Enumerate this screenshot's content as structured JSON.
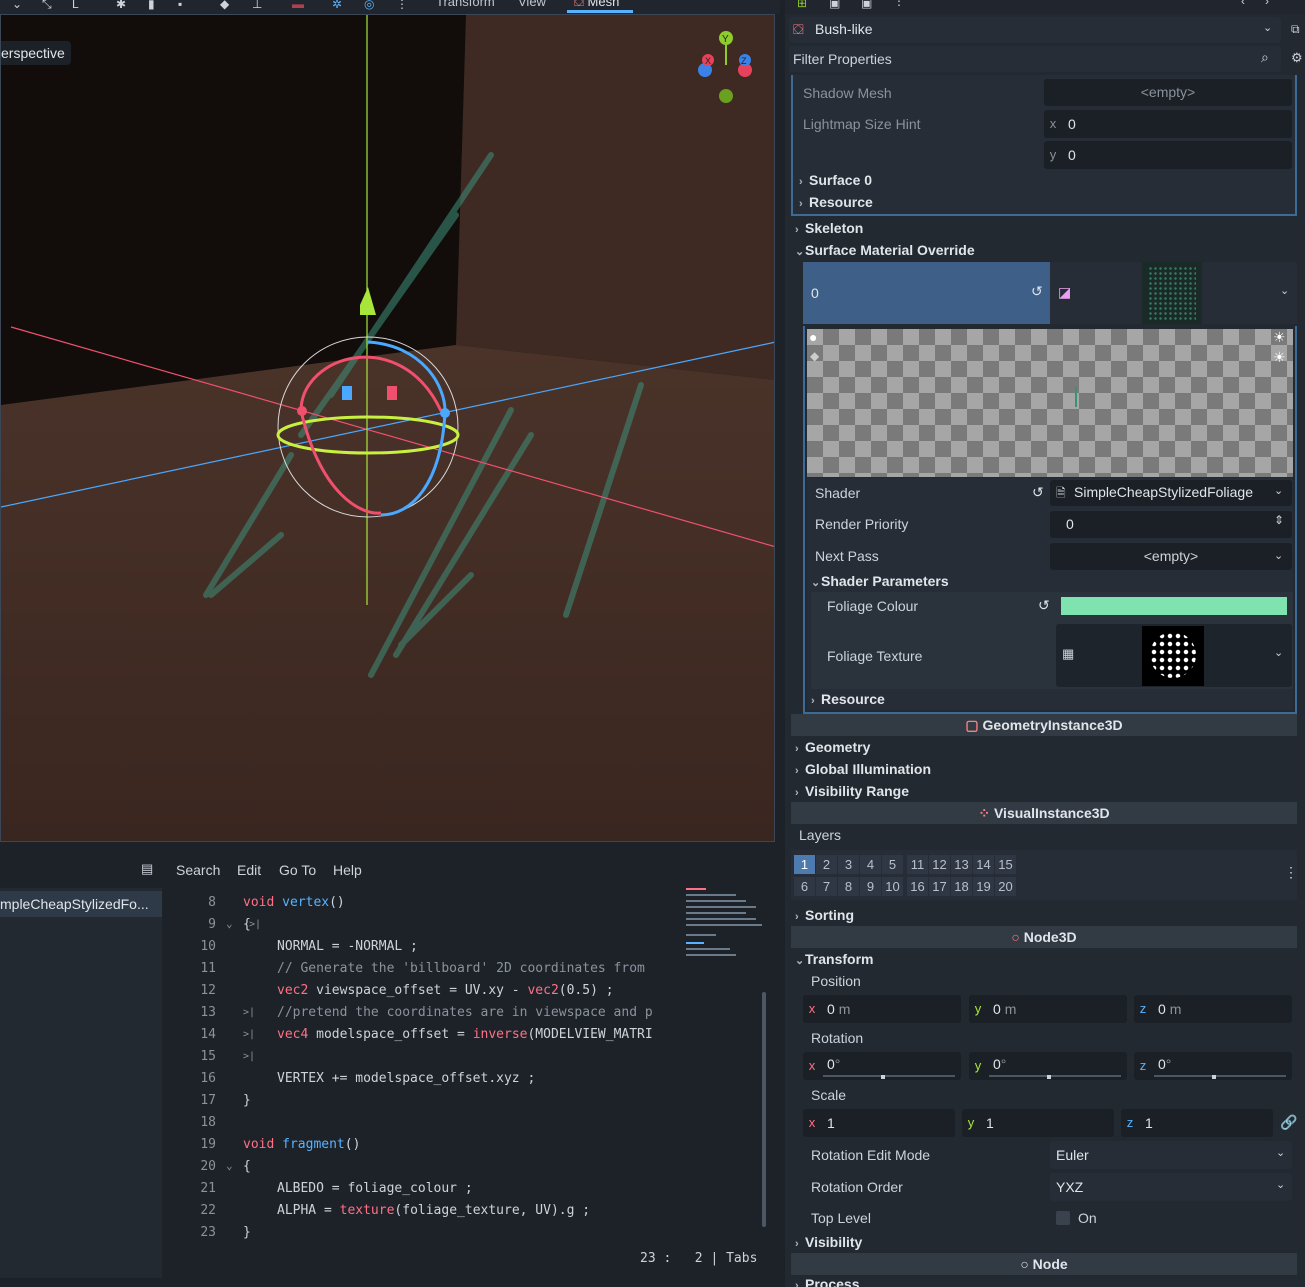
{
  "toolbar": {
    "menus": [
      "Transform",
      "View",
      "Mesh"
    ]
  },
  "viewport": {
    "perspective_label": "erspective",
    "gizmo_axes": [
      "Y",
      "X",
      "Z"
    ]
  },
  "inspector": {
    "resource_name": "Bush-like",
    "filter_placeholder": "Filter Properties",
    "shadow_mesh_label": "Shadow Mesh",
    "shadow_mesh_value": "<empty>",
    "lightmap_label": "Lightmap Size Hint",
    "lightmap_x": "0",
    "lightmap_y": "0",
    "surface0": "Surface 0",
    "resource1": "Resource",
    "skeleton": "Skeleton",
    "surface_override": "Surface Material Override",
    "override_index": "0",
    "shader_label": "Shader",
    "shader_value": "SimpleCheapStylizedFoliage",
    "render_priority_label": "Render Priority",
    "render_priority_value": "0",
    "next_pass_label": "Next Pass",
    "next_pass_value": "<empty>",
    "shader_params": "Shader Parameters",
    "foliage_colour_label": "Foliage Colour",
    "foliage_colour": "#7fe3b0",
    "foliage_texture_label": "Foliage Texture",
    "resource2": "Resource",
    "geometry_instance": "GeometryInstance3D",
    "geometry": "Geometry",
    "global_illum": "Global Illumination",
    "visibility_range": "Visibility Range",
    "visual_instance": "VisualInstance3D",
    "layers_label": "Layers",
    "layers_row1": [
      "1",
      "2",
      "3",
      "4",
      "5",
      "11",
      "12",
      "13",
      "14",
      "15"
    ],
    "layers_row2": [
      "6",
      "7",
      "8",
      "9",
      "10",
      "16",
      "17",
      "18",
      "19",
      "20"
    ],
    "sorting": "Sorting",
    "node3d": "Node3D",
    "transform": "Transform",
    "position_label": "Position",
    "pos_x": "0",
    "pos_y": "0",
    "pos_z": "0",
    "unit_m": "m",
    "rotation_label": "Rotation",
    "rot_x": "0",
    "rot_y": "0",
    "rot_z": "0",
    "deg": "°",
    "scale_label": "Scale",
    "scale_x": "1",
    "scale_y": "1",
    "scale_z": "1",
    "rot_mode_label": "Rotation Edit Mode",
    "rot_mode_value": "Euler",
    "rot_order_label": "Rotation Order",
    "rot_order_value": "YXZ",
    "top_level_label": "Top Level",
    "top_level_value": "On",
    "visibility": "Visibility",
    "node": "Node",
    "process": "Process"
  },
  "script": {
    "menus": [
      "Search",
      "Edit",
      "Go To",
      "Help"
    ],
    "file": "mpleCheapStylizedFo...",
    "status_line": "23 :",
    "status_col": "2",
    "status_indent": "Tabs",
    "lines": [
      {
        "n": "8"
      },
      {
        "n": "9"
      },
      {
        "n": "10"
      },
      {
        "n": "11"
      },
      {
        "n": "12"
      },
      {
        "n": "13"
      },
      {
        "n": "14"
      },
      {
        "n": "15"
      },
      {
        "n": "16"
      },
      {
        "n": "17"
      },
      {
        "n": "18"
      },
      {
        "n": "19"
      },
      {
        "n": "20"
      },
      {
        "n": "21"
      },
      {
        "n": "22"
      },
      {
        "n": "23"
      }
    ],
    "code": {
      "l8a": "void",
      "l8b": "vertex",
      "l8c": "()",
      "l9": "{",
      "l10": "NORMAL = -NORMAL ;",
      "l11": "// Generate the 'billboard' 2D coordinates from",
      "l12a": "vec2",
      "l12b": " viewspace_offset = UV.xy - ",
      "l12c": "vec2",
      "l12d": "(0.5) ;",
      "l13": "//pretend the coordinates are in viewspace and p",
      "l14a": "vec4",
      "l14b": " modelspace_offset = ",
      "l14c": "inverse",
      "l14d": "(MODELVIEW_MATRI",
      "l16": "VERTEX += modelspace_offset.xyz ;",
      "l17": "}",
      "l19a": "void",
      "l19b": "fragment",
      "l19c": "()",
      "l20": "{",
      "l21": "ALBEDO = foliage_colour ;",
      "l22a": "ALPHA = ",
      "l22b": "texture",
      "l22c": "(foliage_texture, UV).g ;",
      "l23": "}"
    }
  }
}
